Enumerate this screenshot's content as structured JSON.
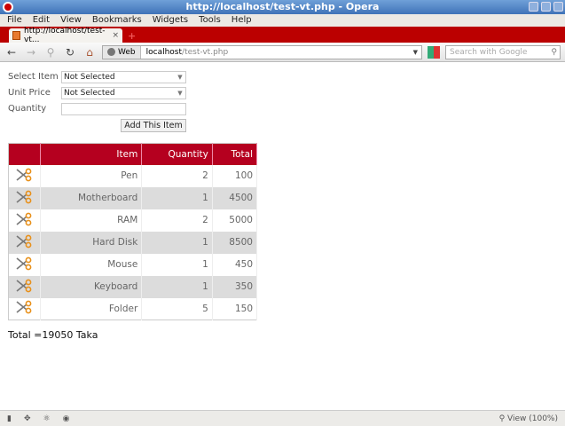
{
  "window": {
    "title": "http://localhost/test-vt.php - Opera"
  },
  "menu": [
    "File",
    "Edit",
    "View",
    "Bookmarks",
    "Widgets",
    "Tools",
    "Help"
  ],
  "tab": {
    "label": "http://localhost/test-vt...",
    "close": "×"
  },
  "address": {
    "badge": "Web",
    "host": "localhost",
    "path": "/test-vt.php"
  },
  "search": {
    "placeholder": "Search with Google"
  },
  "form": {
    "select_item_label": "Select Item",
    "select_item_value": "Not Selected",
    "unit_price_label": "Unit Price",
    "unit_price_value": "Not Selected",
    "quantity_label": "Quantity",
    "quantity_value": "",
    "add_button": "Add This Item"
  },
  "table": {
    "headers": [
      "",
      "Item",
      "Quantity",
      "Total"
    ],
    "rows": [
      [
        "Pen",
        "2",
        "100"
      ],
      [
        "Motherboard",
        "1",
        "4500"
      ],
      [
        "RAM",
        "2",
        "5000"
      ],
      [
        "Hard Disk",
        "1",
        "8500"
      ],
      [
        "Mouse",
        "1",
        "450"
      ],
      [
        "Keyboard",
        "1",
        "350"
      ],
      [
        "Folder",
        "5",
        "150"
      ]
    ]
  },
  "total_text": "Total =19050 Taka",
  "status": {
    "zoom": "View (100%)"
  },
  "colors": {
    "header": "#b5001f",
    "tabbar": "#b00000"
  }
}
